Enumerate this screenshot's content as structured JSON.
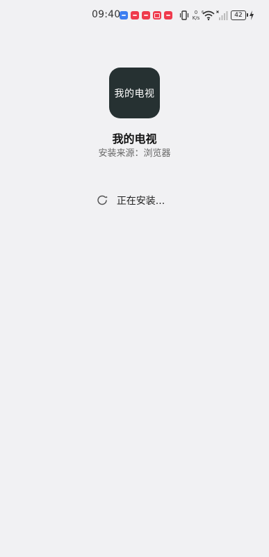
{
  "status_bar": {
    "time": "09:40",
    "net_speed_value": "0",
    "net_speed_unit": "K/s",
    "battery_level": "42",
    "notification_icons": [
      "app-notification-icon",
      "app-notification-icon",
      "app-notification-icon",
      "app-notification-icon",
      "app-notification-icon"
    ],
    "colors": {
      "blue": "#3d7ef0",
      "red": "#ef3b4d"
    }
  },
  "app": {
    "icon_label": "我的电视",
    "name": "我的电视",
    "install_source": "安装来源：浏览器",
    "icon_color": "#263132"
  },
  "install": {
    "status_text": "正在安装..."
  }
}
